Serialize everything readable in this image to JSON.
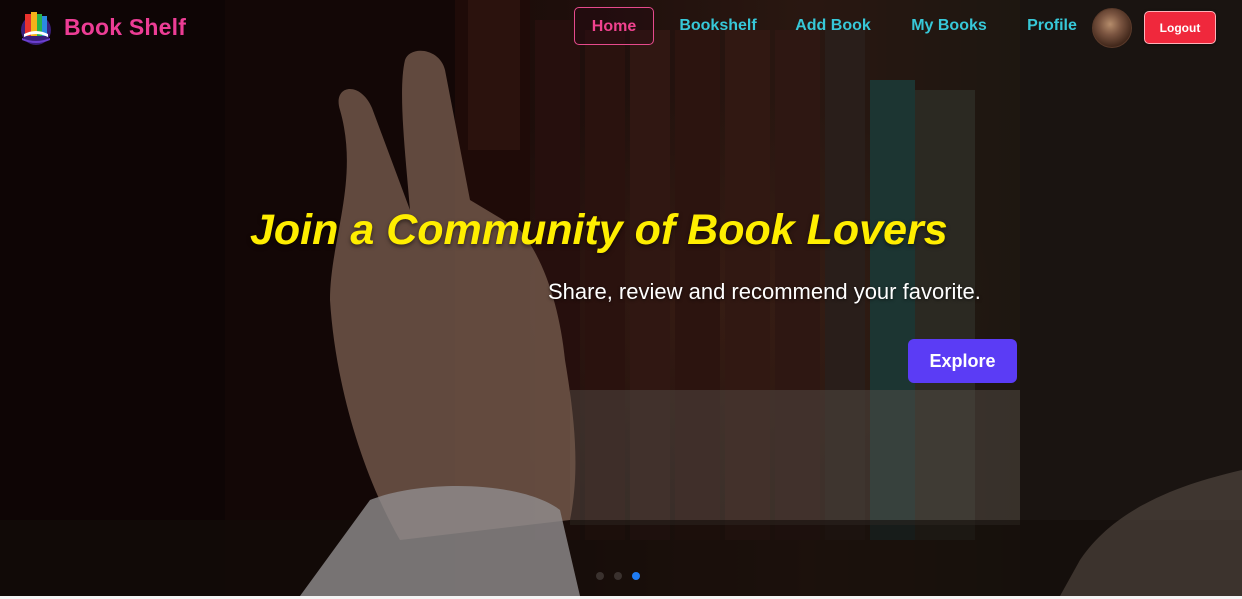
{
  "brand": {
    "name": "Book Shelf",
    "logo_icon": "book-logo-icon"
  },
  "nav": {
    "items": [
      {
        "label": "Home",
        "active": true
      },
      {
        "label": "Bookshelf",
        "active": false
      },
      {
        "label": "Add Book",
        "active": false
      },
      {
        "label": "My Books",
        "active": false
      },
      {
        "label": "Profile",
        "active": false
      }
    ],
    "logout_label": "Logout"
  },
  "hero": {
    "headline": "Join a Community of Book Lovers",
    "subtitle": "Share, review and recommend your favorite.",
    "cta_label": "Explore"
  },
  "carousel": {
    "slides": 3,
    "active_index": 2
  },
  "colors": {
    "brand": "#ec3d95",
    "nav_link": "#37c8d8",
    "nav_active": "#f0428f",
    "headline": "#ffee00",
    "cta": "#5b3cf5",
    "logout": "#f0283c",
    "dot_active": "#1e7bf3"
  }
}
